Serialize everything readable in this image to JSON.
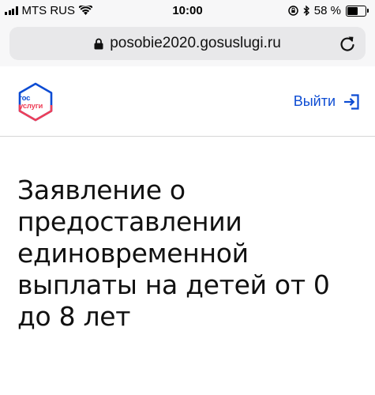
{
  "status_bar": {
    "carrier": "MTS RUS",
    "time": "10:00",
    "battery_percent": "58 %",
    "battery_level": 0.58,
    "icons": [
      "signal-icon",
      "wifi-icon",
      "rotation-lock-icon",
      "bluetooth-icon",
      "battery-icon"
    ]
  },
  "browser": {
    "url": "posobie2020.gosuslugi.ru",
    "icons": [
      "lock-icon",
      "reload-icon"
    ]
  },
  "header": {
    "logo": {
      "line1": "гос",
      "line2": "услуги"
    },
    "logout_label": "Выйти",
    "logout_icon": "logout-icon",
    "colors": {
      "brand_blue": "#0d4cd3",
      "brand_red": "#ee3f58"
    }
  },
  "main": {
    "title": "Заявление о предоставлении единовременной выплаты на детей от 0 до 8 лет"
  }
}
